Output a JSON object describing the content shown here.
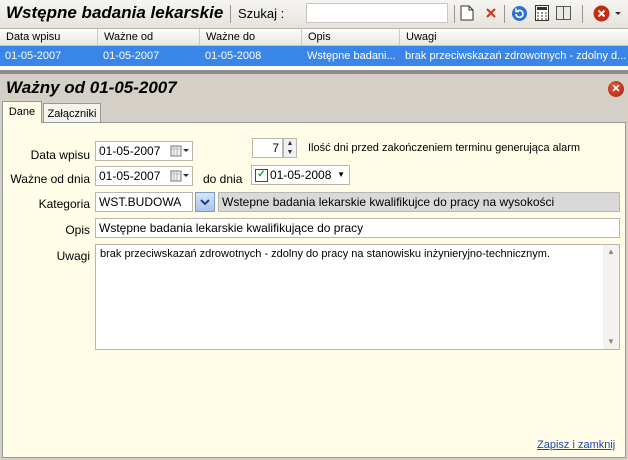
{
  "app": {
    "title": "Wstępne badania lekarskie",
    "search_label": "Szukaj :"
  },
  "toolbar": {
    "icons": [
      "new-document-icon",
      "delete-icon",
      "refresh-icon",
      "calculator-icon",
      "panel-icon",
      "close-icon"
    ]
  },
  "grid": {
    "columns": [
      "Data wpisu",
      "Ważne od",
      "Ważne do",
      "Opis",
      "Uwagi"
    ],
    "rows": [
      [
        "01-05-2007",
        "01-05-2007",
        "01-05-2008",
        "Wstępne badani...",
        "brak przeciwskazań zdrowotnych - zdolny d..."
      ]
    ],
    "selected_color": "#3a85e8"
  },
  "detail": {
    "title": "Ważny od 01-05-2007",
    "tabs": [
      "Dane",
      "Załączniki"
    ],
    "data_wpisu": {
      "label": "Data wpisu",
      "value": "01-05-2007"
    },
    "alarm_days": {
      "value": "7",
      "label": "Ilość dni przed zakończeniem terminu generująca alarm"
    },
    "wazne_od": {
      "label": "Ważne od dnia",
      "value": "01-05-2007"
    },
    "do_dnia": {
      "label": "do dnia",
      "checked": true,
      "value": "01-05-2008"
    },
    "kategoria": {
      "label": "Kategoria",
      "code": "WST.BUDOWA",
      "description": "Wstepne badania lekarskie kwalifikujce do pracy na wysokości"
    },
    "opis": {
      "label": "Opis",
      "value": "Wstępne badania lekarskie kwalifikujące do pracy"
    },
    "uwagi": {
      "label": "Uwagi",
      "value": "brak przeciwskazań zdrowotnych - zdolny do pracy na stanowisku inżynieryjno-technicznym."
    },
    "save_link": "Zapisz i zamknij"
  }
}
